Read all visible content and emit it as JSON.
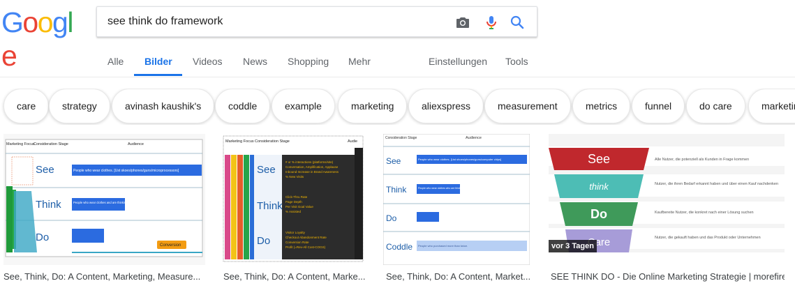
{
  "logo": {
    "letters": [
      "G",
      "o",
      "o",
      "g",
      "l",
      "e"
    ],
    "colors": [
      "#4285F4",
      "#EA4335",
      "#FBBC05",
      "#4285F4",
      "#34A853",
      "#EA4335"
    ]
  },
  "search": {
    "query": "see think do framework",
    "icons": [
      "camera-icon",
      "microphone-icon",
      "search-icon"
    ]
  },
  "tabs": [
    {
      "label": "Alle"
    },
    {
      "label": "Bilder",
      "active": true
    },
    {
      "label": "Videos"
    },
    {
      "label": "News"
    },
    {
      "label": "Shopping"
    },
    {
      "label": "Mehr"
    }
  ],
  "tools": {
    "settings": "Einstellungen",
    "tools": "Tools"
  },
  "chips": [
    "care",
    "strategy",
    "avinash kaushik's",
    "coddle",
    "example",
    "marketing",
    "aliexspress",
    "measurement",
    "metrics",
    "funnel",
    "do care",
    "marketin"
  ],
  "results": [
    {
      "caption": "See, Think, Do: A Content, Marketing, Measure...",
      "thumb": {
        "headers": [
          "Marketing Focus",
          "Consideration Stage",
          "Audience"
        ],
        "stages": [
          "See",
          "Think",
          "Do"
        ],
        "cells": [
          "People who wear clothes. [Ust skoes/phones/guns/microprocessors]",
          "People who wear clothes and are thinking they need some.",
          ""
        ],
        "callout": "Conversion"
      }
    },
    {
      "caption": "See, Think, Do: A Content, Marke...",
      "thumb": {
        "headers": [
          "Marketing Focus",
          "Consideration Stage",
          "Audie"
        ],
        "stages": [
          "See",
          "Think",
          "Do"
        ],
        "see_lines": [
          "# or % interactions (platforms/site)",
          "Conversation, Amplification, Applause",
          "Inbound Increase in Brand Awareness",
          "% New Visits"
        ],
        "think_lines": [
          "Click-Thru Rate",
          "Page Depth",
          "Per Visit Goal Value",
          "% Assisted"
        ],
        "do_lines": [
          "Visitor Loyalty",
          "Checkout Abandonment Rate",
          "Conversion Rate",
          "Profit (=Rev-All Cost-COGS)"
        ]
      }
    },
    {
      "caption": "See, Think, Do: A Content, Market...",
      "thumb": {
        "headers": [
          "Consideration Stage",
          "Audience"
        ],
        "stages": [
          "See",
          "Think",
          "Do",
          "Coddle"
        ],
        "see_cell": "People who wear clothes. [List shoes/phones/guns/computer chips]",
        "think_cell": "People who wear clothes who are thinking they need some.",
        "coddle_cell": "People who purchased more than twice."
      }
    },
    {
      "caption": "SEE THINK DO - Die Online Marketing Strategie | morefire",
      "badge": "vor 3 Tagen",
      "thumb": {
        "stages": [
          "See",
          "think",
          "Do",
          "Care"
        ],
        "stage_colors": [
          "#c0282d",
          "#4dbdb5",
          "#3f9a5a",
          "#a79cd8"
        ],
        "descriptions": [
          "Alle Nutzer, die potenziell als Kunden in Frage kommen",
          "Nutzer, die ihren Bedarf erkannt haben und über einen Kauf nachdenken",
          "Kaufbereite Nutzer, die konkret nach einer Lösung suchen",
          "Nutzer, die gekauft haben und das Produkt oder Unternehmen"
        ]
      }
    }
  ]
}
